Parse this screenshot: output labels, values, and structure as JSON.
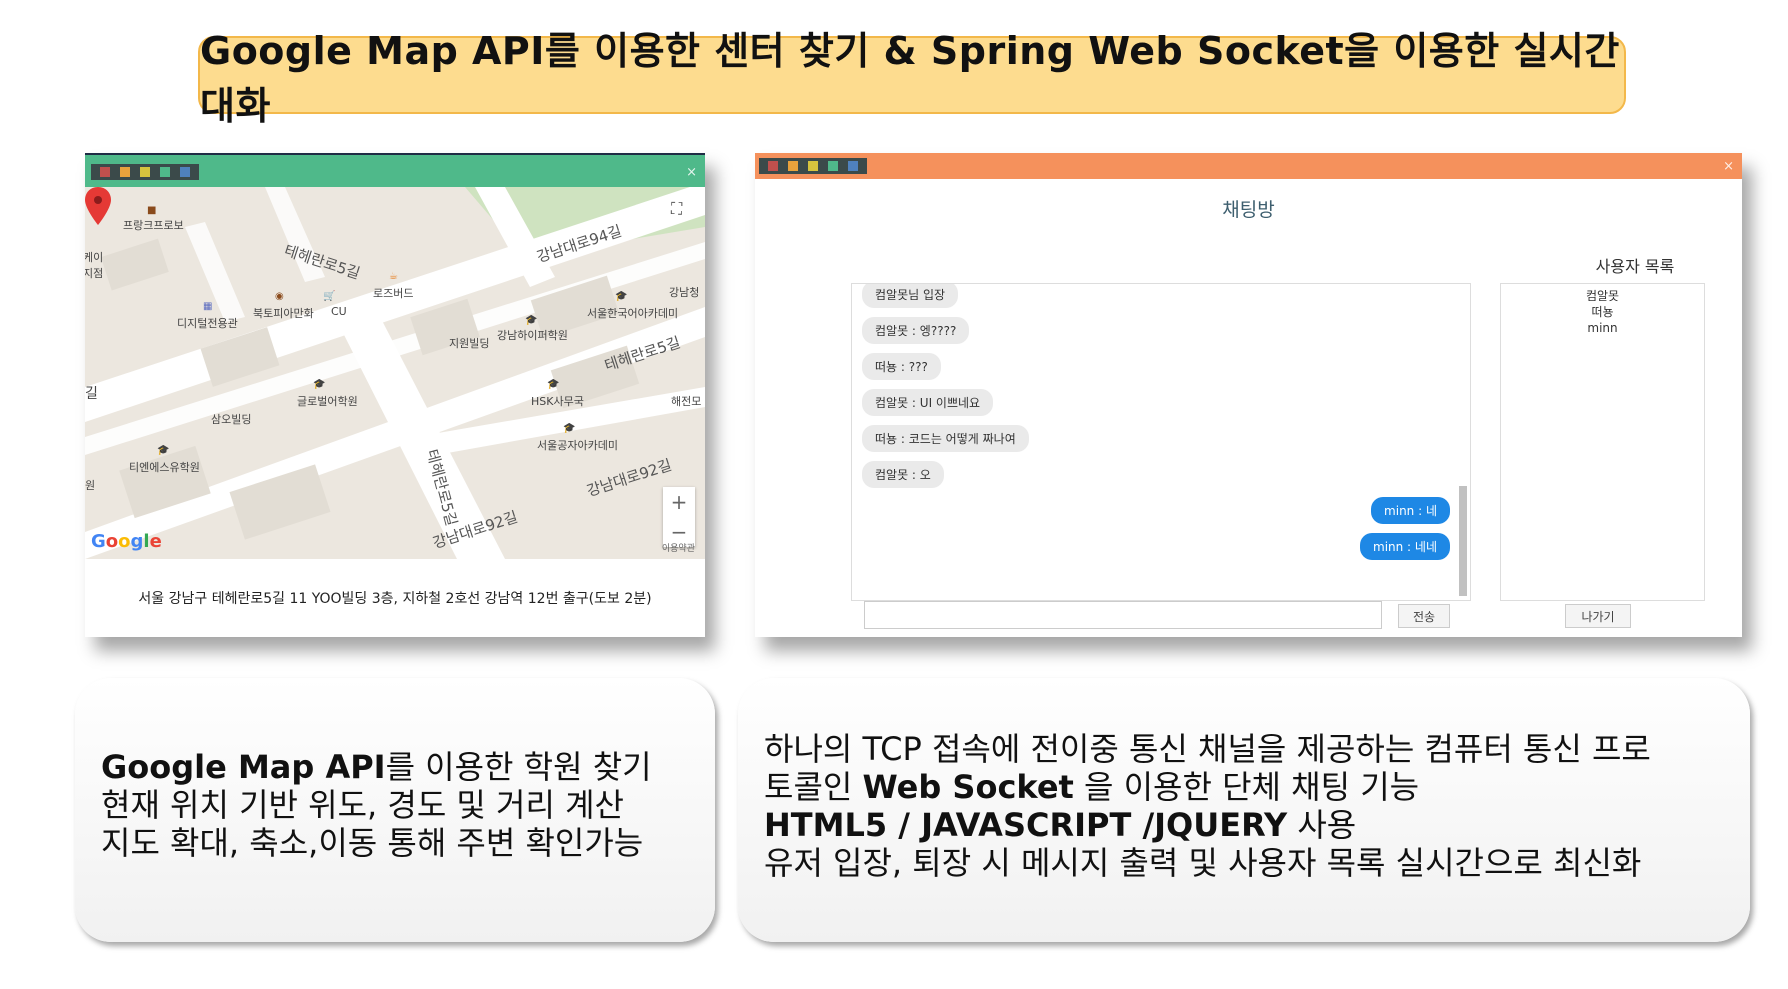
{
  "title": "Google Map API를 이용한 센터 찾기 & Spring Web Socket을 이용한 실시간 대화",
  "colors": {
    "title_bg": "#fddc8f",
    "map_titlebar": "#4fb98a",
    "chat_titlebar": "#f5915c",
    "window_dots": [
      "#c0504d",
      "#e8a23c",
      "#d6c33e",
      "#4fb98a",
      "#4f81bd"
    ],
    "outgoing_bubble": "#1e88e5",
    "incoming_bubble": "#eaeaea"
  },
  "map_window": {
    "close": "×",
    "pois": {
      "frankfurt": "프랑크프로보",
      "gang_top": "케이\n지점",
      "rosebud": "로즈버드",
      "digital": "디지털전용관",
      "northtopia": "북토피아만화",
      "cu": "CU",
      "seoul_korean": "서울한국어아카데미",
      "gangnam_chung": "강남청",
      "jiwon": "지원빌딩",
      "gangnam_high": "강남하이퍼학원",
      "global": "글로벌어학원",
      "samo": "삼오빌딩",
      "hsk": "HSK사무국",
      "haejeon": "해전모",
      "seoul_gongja": "서울공자아카데미",
      "tienes": "티엔에스유학원",
      "ruler": "원",
      "left_edge": "길"
    },
    "roads": {
      "teheran5_a": "테헤란로5길",
      "gangnam94": "강남대로94길",
      "teheran5_b": "테헤란로5길",
      "teheran5_c": "테헤란로5길",
      "gangnam92_a": "강남대로92길",
      "gangnam92_b": "강남대로92길"
    },
    "zoom_in": "+",
    "zoom_out": "−",
    "logo": "Google",
    "terms": "이용약관",
    "address": "서울 강남구 테헤란로5길 11 YOO빌딩 3층, 지하철 2호선 강남역 12번 출구(도보 2분)"
  },
  "chat_window": {
    "close": "×",
    "room_title": "채팅방",
    "user_list_title": "사용자 목록",
    "messages": [
      {
        "type": "in",
        "text": "컴알못님 입장"
      },
      {
        "type": "in",
        "text": "컴알못 : 엥????"
      },
      {
        "type": "in",
        "text": "떠뇽 : ???"
      },
      {
        "type": "in",
        "text": "컴알못 : UI 이쁘네요"
      },
      {
        "type": "in",
        "text": "떠뇽 : 코드는 어떻게 짜나여"
      },
      {
        "type": "in",
        "text": "컴알못 : 오"
      },
      {
        "type": "out",
        "text": "minn : 네"
      },
      {
        "type": "out",
        "text": "minn : 네네"
      }
    ],
    "users": [
      "컴알못",
      "떠뇽",
      "minn"
    ],
    "input_value": "",
    "send_label": "전송",
    "leave_label": "나가기"
  },
  "caption_left": {
    "line1_bold": "Google Map API",
    "line1_rest": "를 이용한 학원 찾기",
    "line2": "현재 위치 기반 위도, 경도 및 거리 계산",
    "line3": "지도 확대, 축소,이동 통해 주변 확인가능"
  },
  "caption_right": {
    "line1": "하나의 TCP 접속에 전이중 통신 채널을 제공하는 컴퓨터 통신 프로",
    "line2_pre": "토콜인 ",
    "line2_bold": "Web Socket",
    "line2_rest": " 을 이용한 단체 채팅 기능",
    "line3_bold": "HTML5 / JAVASCRIPT /JQUERY",
    "line3_rest": " 사용",
    "line4": "유저 입장, 퇴장 시 메시지 출력 및 사용자 목록 실시간으로 최신화"
  }
}
